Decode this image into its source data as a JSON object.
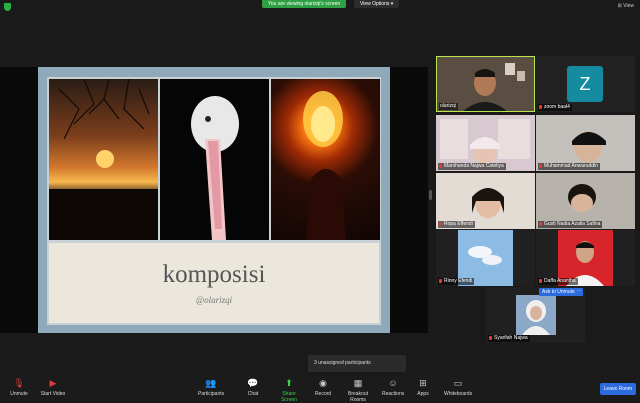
{
  "topbar": {
    "viewing_banner": "You are viewing olarizqi's screen",
    "view_options": "View Options ▾",
    "view_button": "⊞ View"
  },
  "slide": {
    "title": "komposisi",
    "subtitle": "@olarizqi"
  },
  "participants": [
    {
      "name": "olarizqi",
      "muted": false,
      "speaking": true
    },
    {
      "name": "zoom baal4",
      "muted": true,
      "avatar_letter": "Z"
    },
    {
      "name": "Marshanda Najwa Cateliya",
      "muted": true
    },
    {
      "name": "Muhammad Anwaruddin",
      "muted": true
    },
    {
      "name": "Ropa Effendi",
      "muted": true
    },
    {
      "name": "Gusti Nadia Azalia Safina",
      "muted": true
    },
    {
      "name": "Rinny Efendi",
      "muted": true
    },
    {
      "name": "Daffa Anantha",
      "muted": true
    },
    {
      "name": "Syarifah Najwa",
      "muted": true
    }
  ],
  "ask_to_unmute": "Ask to Unmute",
  "more_button": "···",
  "unassigned": "3 unassigned participants",
  "toolbar": {
    "unmute": "Unmute",
    "start_video": "Start Video",
    "participants": "Participants",
    "chat": "Chat",
    "share_screen": "Share Screen",
    "record": "Record",
    "breakout_rooms": "Breakout Rooms",
    "reactions": "Reactions",
    "apps": "Apps",
    "whiteboards": "Whiteboards",
    "leave": "Leave Room",
    "participant_count": "9",
    "chat_badge": ""
  },
  "colors": {
    "accent_green": "#2ea043",
    "speaker_border": "#b9e64a",
    "blue": "#2b6bde",
    "slide_frame": "#8fa9b8",
    "avatar_bg": "#148b9e"
  }
}
